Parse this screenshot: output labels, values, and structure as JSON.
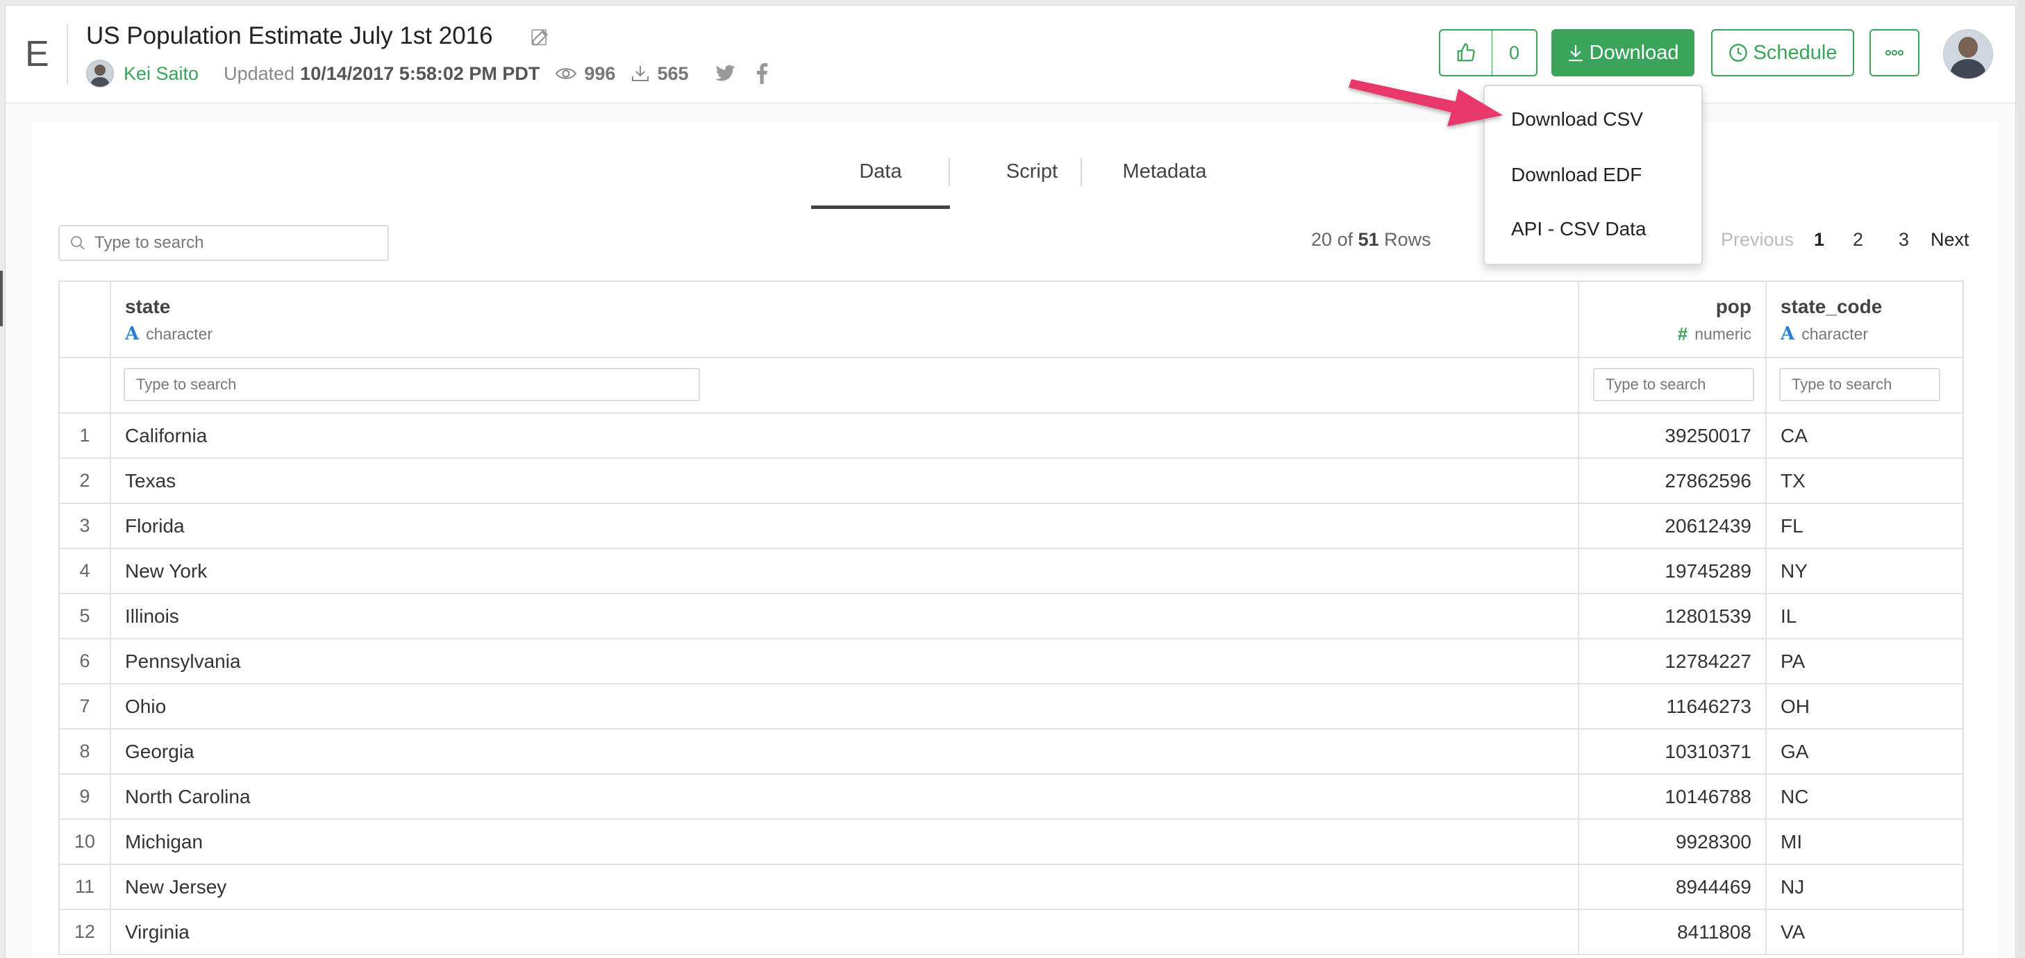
{
  "header": {
    "logo": "E",
    "title": "US Population Estimate July 1st 2016",
    "author": "Kei Saito",
    "updated_label": "Updated",
    "updated_at": "10/14/2017 5:58:02 PM PDT",
    "views": "996",
    "downloads": "565",
    "like_count": "0",
    "download_label": "Download",
    "schedule_label": "Schedule"
  },
  "tabs": [
    {
      "label": "Data",
      "active": true
    },
    {
      "label": "Script",
      "active": false
    },
    {
      "label": "Metadata",
      "active": false
    }
  ],
  "search": {
    "placeholder": "Type to search"
  },
  "rows_info": {
    "shown": "20",
    "of_label": "of",
    "total": "51",
    "rows_label": "Rows"
  },
  "pagination": {
    "previous": "Previous",
    "pages": [
      "1",
      "2",
      "3"
    ],
    "current": "1",
    "next": "Next"
  },
  "download_menu": {
    "items": [
      "Download CSV",
      "Download EDF",
      "API - CSV Data"
    ]
  },
  "table": {
    "columns": [
      {
        "name": "state",
        "type": "character",
        "type_icon": "A"
      },
      {
        "name": "pop",
        "type": "numeric",
        "type_icon": "#"
      },
      {
        "name": "state_code",
        "type": "character",
        "type_icon": "A"
      }
    ],
    "column_search_placeholder": "Type to search",
    "rows": [
      {
        "n": "1",
        "state": "California",
        "pop": "39250017",
        "code": "CA"
      },
      {
        "n": "2",
        "state": "Texas",
        "pop": "27862596",
        "code": "TX"
      },
      {
        "n": "3",
        "state": "Florida",
        "pop": "20612439",
        "code": "FL"
      },
      {
        "n": "4",
        "state": "New York",
        "pop": "19745289",
        "code": "NY"
      },
      {
        "n": "5",
        "state": "Illinois",
        "pop": "12801539",
        "code": "IL"
      },
      {
        "n": "6",
        "state": "Pennsylvania",
        "pop": "12784227",
        "code": "PA"
      },
      {
        "n": "7",
        "state": "Ohio",
        "pop": "11646273",
        "code": "OH"
      },
      {
        "n": "8",
        "state": "Georgia",
        "pop": "10310371",
        "code": "GA"
      },
      {
        "n": "9",
        "state": "North Carolina",
        "pop": "10146788",
        "code": "NC"
      },
      {
        "n": "10",
        "state": "Michigan",
        "pop": "9928300",
        "code": "MI"
      },
      {
        "n": "11",
        "state": "New Jersey",
        "pop": "8944469",
        "code": "NJ"
      },
      {
        "n": "12",
        "state": "Virginia",
        "pop": "8411808",
        "code": "VA"
      }
    ]
  },
  "colors": {
    "accent": "#3aa45b",
    "arrow": "#e8386a",
    "type_character": "#2c7fd6"
  }
}
